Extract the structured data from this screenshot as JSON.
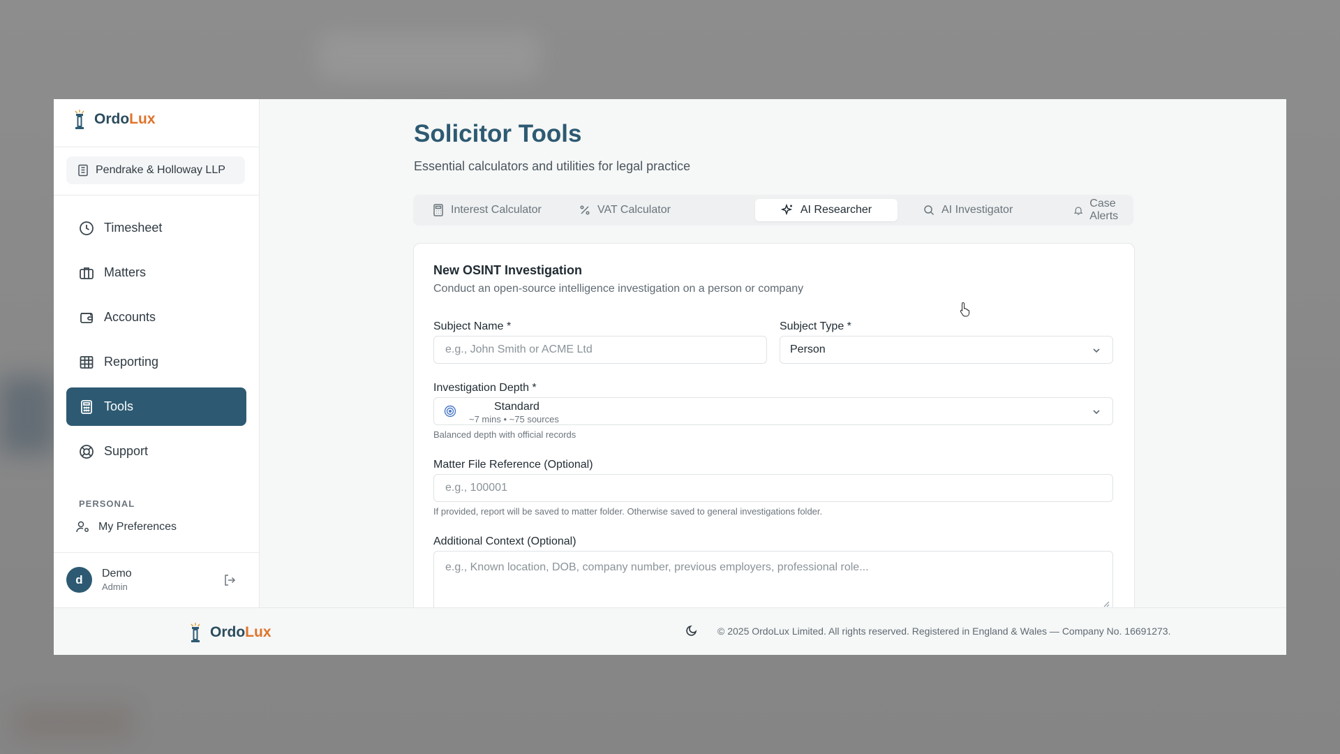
{
  "brand": {
    "name_main": "Ordo",
    "name_accent": "Lux"
  },
  "sidebar": {
    "firm": "Pendrake & Holloway LLP",
    "items": [
      {
        "label": "Timesheet",
        "icon": "clock-icon"
      },
      {
        "label": "Matters",
        "icon": "briefcase-icon"
      },
      {
        "label": "Accounts",
        "icon": "wallet-icon"
      },
      {
        "label": "Reporting",
        "icon": "table-icon"
      },
      {
        "label": "Tools",
        "icon": "calculator-icon",
        "active": true
      },
      {
        "label": "Support",
        "icon": "lifebuoy-icon"
      }
    ],
    "section_personal": "PERSONAL",
    "preferences": "My Preferences",
    "user": {
      "initial": "d",
      "name": "Demo",
      "role": "Admin"
    }
  },
  "page": {
    "title": "Solicitor Tools",
    "subtitle": "Essential calculators and utilities for legal practice"
  },
  "tabs": [
    {
      "label": "Interest Calculator",
      "icon": "calculator-icon"
    },
    {
      "label": "VAT Calculator",
      "icon": "percent-icon"
    },
    {
      "label": "AI Researcher",
      "icon": "sparkles-icon",
      "active": true
    },
    {
      "label": "AI Investigator",
      "icon": "search-icon"
    },
    {
      "label": "Case Alerts",
      "icon": "bell-icon"
    }
  ],
  "form": {
    "title": "New OSINT Investigation",
    "description": "Conduct an open-source intelligence investigation on a person or company",
    "subject_name_label": "Subject Name *",
    "subject_name_placeholder": "e.g., John Smith or ACME Ltd",
    "subject_type_label": "Subject Type *",
    "subject_type_value": "Person",
    "depth_label": "Investigation Depth *",
    "depth_value": "Standard",
    "depth_meta": "~7 mins • ~75 sources",
    "depth_hint": "Balanced depth with official records",
    "matter_label": "Matter File Reference (Optional)",
    "matter_placeholder": "e.g., 100001",
    "matter_hint": "If provided, report will be saved to matter folder. Otherwise saved to general investigations folder.",
    "context_label": "Additional Context (Optional)",
    "context_placeholder": "e.g., Known location, DOB, company number, previous employers, professional role..."
  },
  "footer": {
    "copyright": "© 2025 OrdoLux Limited. All rights reserved. Registered in England & Wales — Company No. 16691273."
  },
  "colors": {
    "primary": "#2d5a72",
    "accent": "#e0732a"
  }
}
